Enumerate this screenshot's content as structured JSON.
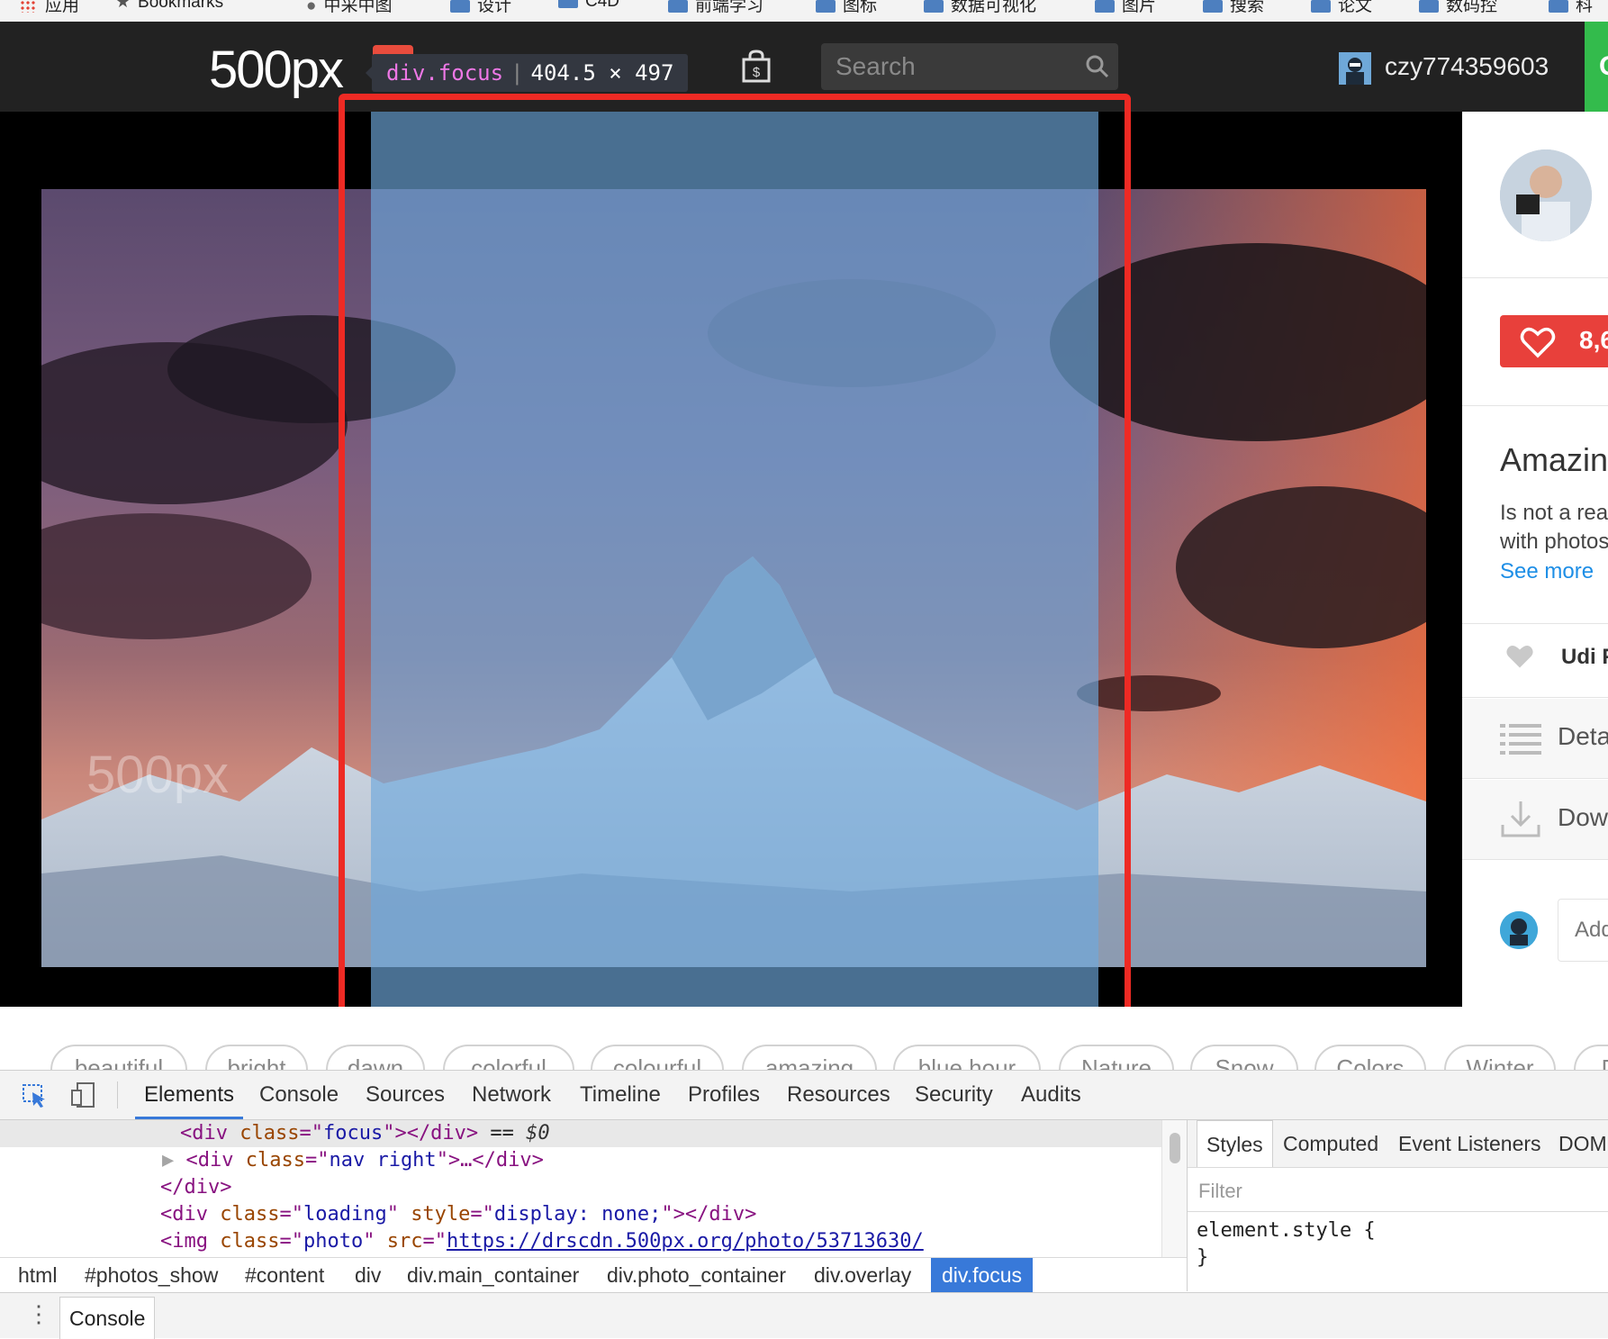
{
  "bookmarks_bar": {
    "items": [
      {
        "label": "应用",
        "icon": "apps-grid-icon"
      },
      {
        "label": "Bookmarks",
        "icon": "star-icon"
      },
      {
        "label": "中采中图",
        "icon": "globe-icon"
      },
      {
        "label": "设计",
        "icon": "folder-icon"
      },
      {
        "label": "C4D",
        "icon": "folder-icon"
      },
      {
        "label": "前端学习",
        "icon": "folder-icon"
      },
      {
        "label": "图标",
        "icon": "folder-icon"
      },
      {
        "label": "数据可视化",
        "icon": "folder-icon"
      },
      {
        "label": "图片",
        "icon": "folder-icon"
      },
      {
        "label": "搜索",
        "icon": "folder-icon"
      },
      {
        "label": "论文",
        "icon": "folder-icon"
      },
      {
        "label": "数码控",
        "icon": "folder-icon"
      },
      {
        "label": "科",
        "icon": "folder-icon"
      }
    ]
  },
  "header": {
    "logo_text": "500px",
    "search_placeholder": "Search",
    "username": "czy774359603",
    "green_button_label": "G",
    "accent_color": "#33bb4c"
  },
  "inspector_tooltip": {
    "tag": "div",
    "class_name": ".focus",
    "dimensions": "404.5 × 497"
  },
  "photo": {
    "watermark": "500px"
  },
  "sidebar": {
    "like_count": "8,6",
    "like_color": "#e8403b",
    "title": "Amazin",
    "description_line1": "Is not a rea",
    "description_line2": "with photos",
    "see_more": "See more",
    "liker": "Udi F",
    "details_label": "Deta",
    "download_label": "Dow",
    "comment_placeholder": "Add"
  },
  "tags": [
    "beautiful",
    "bright",
    "dawn",
    "colorful",
    "colourful",
    "amazing",
    "blue hour",
    "Nature",
    "Snow",
    "Colors",
    "Winter",
    "D"
  ],
  "devtools": {
    "tabs": [
      "Elements",
      "Console",
      "Sources",
      "Network",
      "Timeline",
      "Profiles",
      "Resources",
      "Security",
      "Audits"
    ],
    "active_tab": "Elements",
    "dom_lines": {
      "l1": {
        "open": "<div ",
        "attr": "class",
        "eq": "=\"",
        "val": "focus",
        "close": "\"></div>",
        "marker": " == ",
        "ref": "$0"
      },
      "l2": {
        "triangle": "▶",
        "open": "<div ",
        "attr": "class",
        "eq": "=\"",
        "val": "nav right",
        "close": "\">…</div>"
      },
      "l3": {
        "text": "</div>"
      },
      "l4": {
        "open": "<div ",
        "attr": "class",
        "eq": "=\"",
        "val": "loading",
        "mid": "\" ",
        "attr2": "style",
        "eq2": "=\"",
        "val2": "display: none;",
        "close": "\"></div>"
      },
      "l5": {
        "open": "<img ",
        "attr": "class",
        "eq": "=\"",
        "val": "photo",
        "mid": "\" ",
        "attr2": "src",
        "eq2": "=\"",
        "link": "https://drscdn.500px.org/photo/53713630/"
      }
    },
    "breadcrumbs": [
      "html",
      "#photos_show",
      "#content",
      "div",
      "div.main_container",
      "div.photo_container",
      "div.overlay",
      "div.focus"
    ],
    "active_breadcrumb": "div.focus",
    "styles_tabs": [
      "Styles",
      "Computed",
      "Event Listeners",
      "DOM"
    ],
    "styles_filter_placeholder": "Filter",
    "element_style_open": "element.style {",
    "element_style_close": "}",
    "drawer_tab": "Console"
  }
}
